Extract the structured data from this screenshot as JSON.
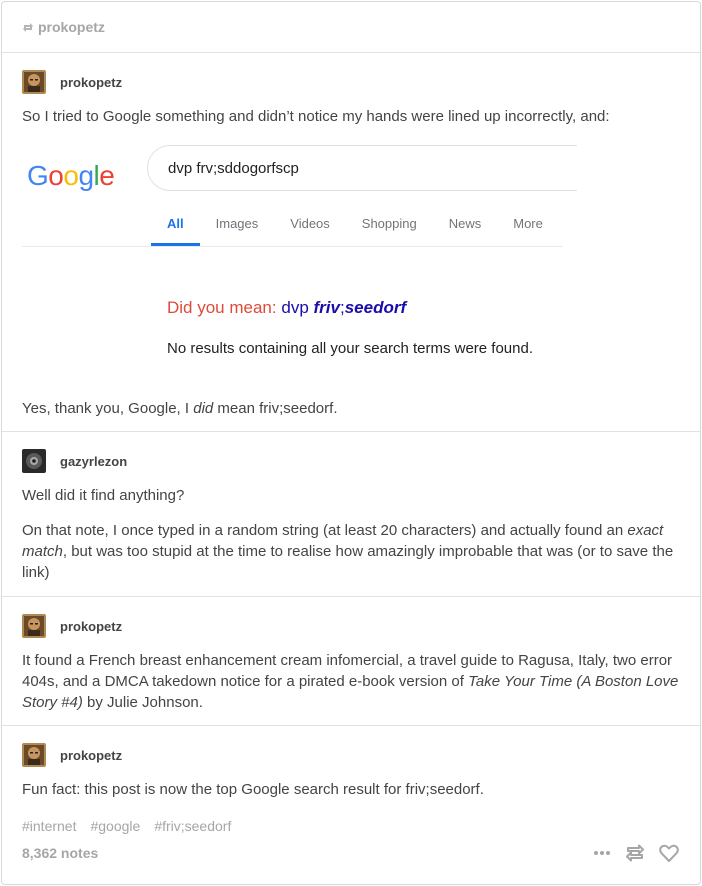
{
  "header": {
    "reblog_user": "prokopetz"
  },
  "posts": [
    {
      "username": "prokopetz",
      "paragraphs": [
        "So I tried to Google something and didn’t notice my hands were lined up incorrectly, and:"
      ],
      "google": {
        "logo_letters": [
          "G",
          "o",
          "o",
          "g",
          "l",
          "e"
        ],
        "logo_colors": [
          "#4285f4",
          "#ea4335",
          "#fbbc05",
          "#4285f4",
          "#34a853",
          "#ea4335"
        ],
        "query": "dvp frv;sddogorfscp",
        "tabs": [
          "All",
          "Images",
          "Videos",
          "Shopping",
          "News",
          "More"
        ],
        "active_tab": "All",
        "did_you_mean_label": "Did you mean:",
        "suggestion_plain": "dvp",
        "suggestion_bold1": "friv",
        "suggestion_sep": ";",
        "suggestion_bold2": "seedorf",
        "no_results": "No results containing all your search terms were found."
      },
      "after_text_1": "Yes, thank you, Google, I ",
      "after_text_em": "did",
      "after_text_2": " mean friv;seedorf."
    },
    {
      "username": "gazyrlezon",
      "p1": "Well did it find anything?",
      "p2_a": "On that note, I once typed in a random string (at least 20 characters) and actually found an ",
      "p2_em": "exact match",
      "p2_b": ", but was too stupid at the time to realise how amazingly improbable that was (or to save the link)"
    },
    {
      "username": "prokopetz",
      "p1_a": "It found a French breast enhancement cream infomercial, a travel guide to Ragusa, Italy, two error 404s, and a DMCA takedown notice for a pirated e-book version of ",
      "p1_em": "Take Your Time (A Boston Love Story #4)",
      "p1_b": " by Julie Johnson."
    },
    {
      "username": "prokopetz",
      "p1": "Fun fact: this post is now the top Google search result for friv;seedorf."
    }
  ],
  "tags": [
    "#internet",
    "#google",
    "#friv;seedorf"
  ],
  "footer": {
    "notes": "8,362 notes"
  },
  "icons": [
    "reblog-icon",
    "avatar",
    "more-icon",
    "heart-icon"
  ]
}
